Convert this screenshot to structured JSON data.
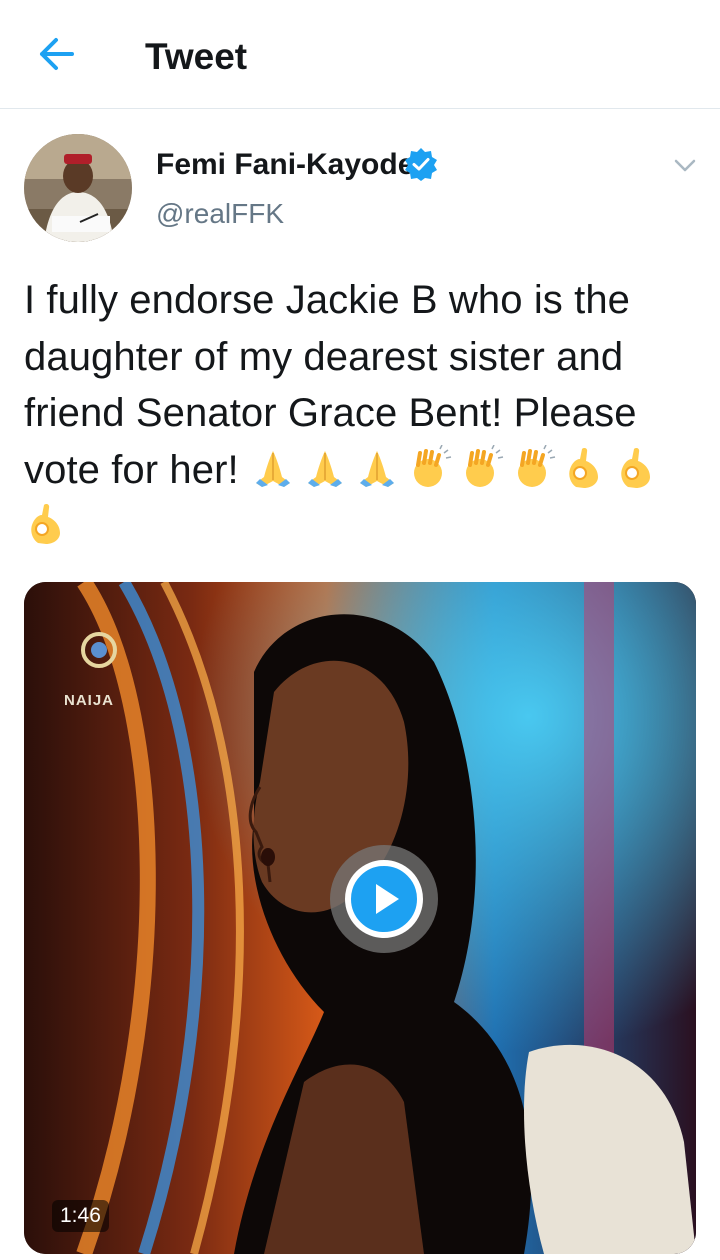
{
  "header": {
    "title": "Tweet",
    "back_icon": "arrow-left-icon",
    "accent_color": "#1da1f2"
  },
  "author": {
    "name": "Femi Fani-Kayode",
    "handle": "@realFFK",
    "verified": true,
    "verified_icon": "verified-badge-icon",
    "menu_icon": "chevron-down-icon"
  },
  "tweet": {
    "text": "I fully endorse Jackie B who is the daughter of my dearest sister and friend Senator Grace Bent! Please vote for her!",
    "emojis": [
      "folded-hands-icon",
      "folded-hands-icon",
      "folded-hands-icon",
      "clapping-hands-icon",
      "clapping-hands-icon",
      "clapping-hands-icon",
      "ok-hand-icon",
      "ok-hand-icon",
      "ok-hand-icon"
    ]
  },
  "media": {
    "type": "video",
    "duration": "1:46",
    "watermark": "NAIJA",
    "play_icon": "play-icon"
  }
}
